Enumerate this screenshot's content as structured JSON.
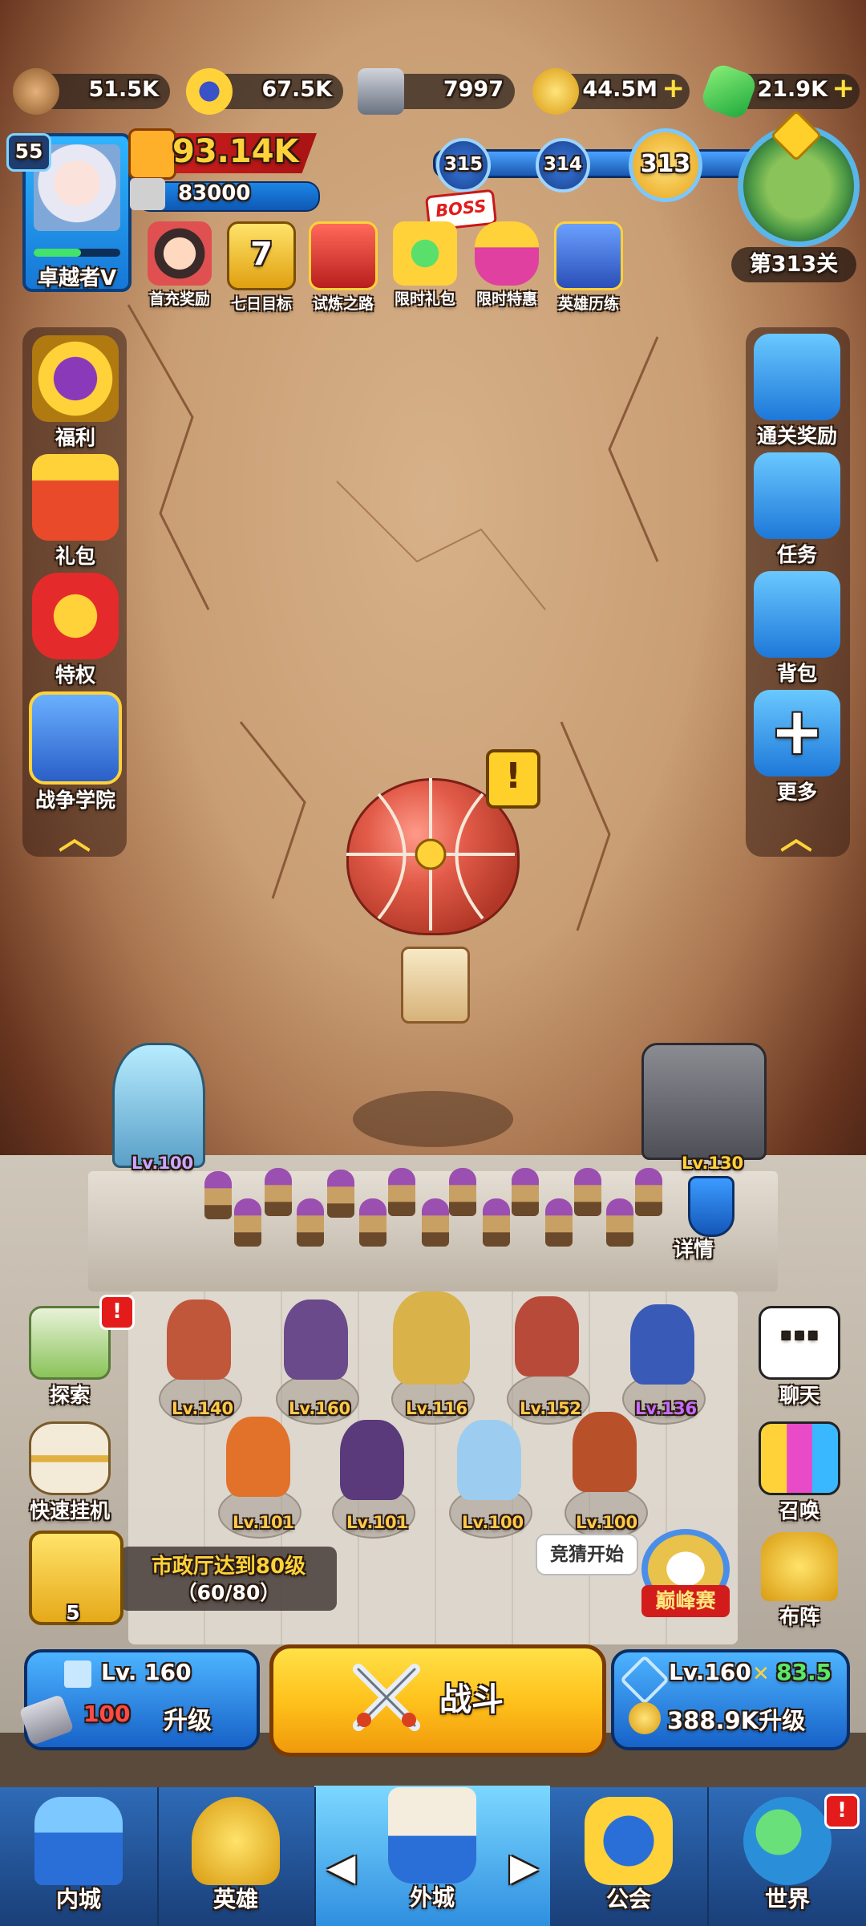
{
  "resources": [
    {
      "icon": "wood-log-icon",
      "value": "51.5K",
      "plus": false
    },
    {
      "icon": "gold-star-coin-icon",
      "value": "67.5K",
      "plus": false
    },
    {
      "icon": "iron-ingot-icon",
      "value": "7997",
      "plus": false
    },
    {
      "icon": "gold-coin-icon",
      "value": "44.5M",
      "plus": true
    },
    {
      "icon": "green-gem-icon",
      "value": "21.9K",
      "plus": true
    }
  ],
  "player": {
    "level": "55",
    "rank": "卓越者Ⅴ",
    "power": "93.14K",
    "cp": "83000",
    "xp_fraction": 0.55
  },
  "stages": {
    "next2": "315",
    "next1": "314",
    "current": "313",
    "boss": "BOSS",
    "label": "第313关"
  },
  "events": [
    {
      "icon": "first-recharge-icon",
      "label": "首充奖励"
    },
    {
      "icon": "seven-day-goal-icon",
      "label": "七日目标",
      "badge": "7"
    },
    {
      "icon": "trial-road-icon",
      "label": "试炼之路"
    },
    {
      "icon": "limited-gift-icon",
      "label": "限时礼包"
    },
    {
      "icon": "limited-offer-icon",
      "label": "限时特惠"
    },
    {
      "icon": "hero-training-icon",
      "label": "英雄历练"
    }
  ],
  "left_menu": [
    {
      "icon": "welfare-crown-icon",
      "label": "福利"
    },
    {
      "icon": "gift-box-icon",
      "label": "礼包"
    },
    {
      "icon": "privilege-crown-icon",
      "label": "特权"
    },
    {
      "icon": "war-academy-icon",
      "label": "战争学院"
    }
  ],
  "right_menu": [
    {
      "icon": "clear-reward-gift-icon",
      "label": "通关奖励"
    },
    {
      "icon": "task-clipboard-icon",
      "label": "任务"
    },
    {
      "icon": "backpack-icon",
      "label": "背包"
    },
    {
      "icon": "more-plus-icon",
      "label": "更多"
    }
  ],
  "alert_mark": "!",
  "towers": {
    "left_lv": "Lv.100",
    "right_lv": "Lv.130",
    "detail": "详情"
  },
  "heroes_row1": [
    {
      "lv": "Lv.140",
      "color": "#c0563a",
      "purple": false
    },
    {
      "lv": "Lv.160",
      "color": "#6a4a8a",
      "purple": false
    },
    {
      "lv": "Lv.116",
      "color": "#d9b24a",
      "purple": false
    },
    {
      "lv": "Lv.152",
      "color": "#b84a3a",
      "purple": false
    },
    {
      "lv": "Lv.136",
      "color": "#3a5ab8",
      "purple": true
    }
  ],
  "heroes_row2": [
    {
      "lv": "Lv.101",
      "color": "#e2712a"
    },
    {
      "lv": "Lv.101",
      "color": "#5a3a7a"
    },
    {
      "lv": "Lv.100",
      "color": "#9ccdf0"
    },
    {
      "lv": "Lv.100",
      "color": "#b8502a"
    }
  ],
  "left_buttons": [
    {
      "icon": "explore-map-icon",
      "label": "探索",
      "badge": "!"
    },
    {
      "icon": "hourglass-icon",
      "label": "快速挂机"
    }
  ],
  "right_buttons": [
    {
      "icon": "chat-bubble-icon",
      "label": "聊天"
    },
    {
      "icon": "summon-cards-icon",
      "label": "召唤"
    },
    {
      "icon": "formation-rook-icon",
      "label": "布阵"
    }
  ],
  "quest": {
    "title": "市政厅达到80级",
    "progress": "（60/80）",
    "count": "5"
  },
  "peak": {
    "bubble": "竞猜开始",
    "label": "巅峰赛"
  },
  "castle_upgrade": {
    "lv": "Lv. 160",
    "cost": "100",
    "action": "升级"
  },
  "battle": {
    "label": "战斗"
  },
  "army_upgrade": {
    "lv": "Lv.160",
    "power": "83.5",
    "cost": "388.9K升级"
  },
  "nav": [
    {
      "icon": "inner-city-castle-icon",
      "label": "内城"
    },
    {
      "icon": "hero-helmet-icon",
      "label": "英雄"
    },
    {
      "icon": "outer-city-tower-icon",
      "label": "外城",
      "active": true
    },
    {
      "icon": "guild-handshake-icon",
      "label": "公会"
    },
    {
      "icon": "world-globe-icon",
      "label": "世界",
      "badge": "!"
    }
  ],
  "colors": {
    "gold": "#ffd23a",
    "blue": "#1f6fd6",
    "red": "#e41b1b",
    "battle": "#ffc21c"
  }
}
